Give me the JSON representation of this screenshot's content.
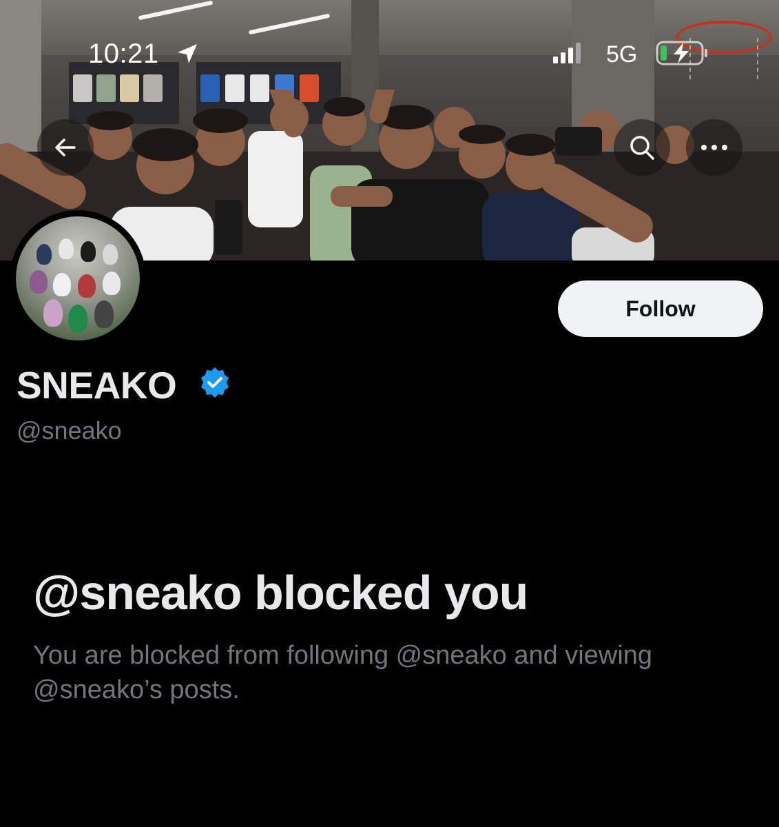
{
  "status_bar": {
    "time": "10:21",
    "network": "5G",
    "icons": [
      "location-arrow-icon",
      "signal-bars-icon",
      "battery-charging-icon"
    ]
  },
  "header": {
    "back_icon": "arrow-left-icon",
    "search_icon": "search-icon",
    "more_icon": "more-horizontal-icon"
  },
  "profile": {
    "follow_label": "Follow",
    "display_name": "SNEAKO",
    "handle": "@sneako",
    "verified_icon": "verified-badge-icon"
  },
  "blocked": {
    "title": "@sneako blocked you",
    "description": "You are blocked from following @sneako and viewing @sneako’s posts."
  },
  "colors": {
    "background": "#000000",
    "primary_text": "#e7e9ea",
    "secondary_text": "#71767b",
    "verified": "#1d9bf0",
    "follow_bg": "#eff3f4"
  }
}
